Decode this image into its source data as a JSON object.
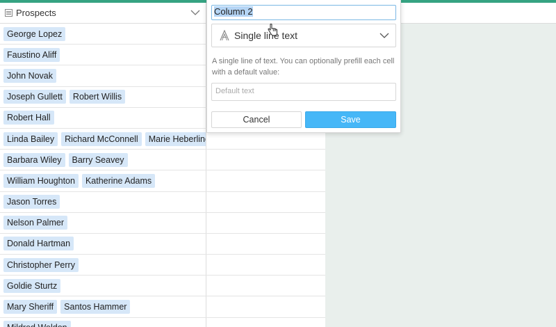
{
  "column1": {
    "title": "Prospects",
    "icon": "list-lines-icon"
  },
  "rows": [
    [
      "George Lopez"
    ],
    [
      "Faustino Aliff"
    ],
    [
      "John Novak"
    ],
    [
      "Joseph Gullett",
      "Robert Willis"
    ],
    [
      "Robert Hall"
    ],
    [
      "Linda Bailey",
      "Richard McConnell",
      "Marie Heberling"
    ],
    [
      "Barbara Wiley",
      "Barry Seavey"
    ],
    [
      "William Houghton",
      "Katherine Adams"
    ],
    [
      "Jason Torres"
    ],
    [
      "Nelson Palmer"
    ],
    [
      "Donald Hartman"
    ],
    [
      "Christopher Perry"
    ],
    [
      "Goldie Sturtz"
    ],
    [
      "Mary Sheriff",
      "Santos Hammer"
    ],
    [
      "Mildred Weldon"
    ]
  ],
  "popup": {
    "name_value": "Column 2",
    "field_type": "Single line text",
    "description": "A single line of text. You can optionally prefill each cell with a default value:",
    "default_placeholder": "Default text",
    "cancel_label": "Cancel",
    "save_label": "Save"
  },
  "colors": {
    "accent_bar": "#36a382",
    "chip": "#d6e7f8",
    "save_button": "#46b7f7"
  }
}
